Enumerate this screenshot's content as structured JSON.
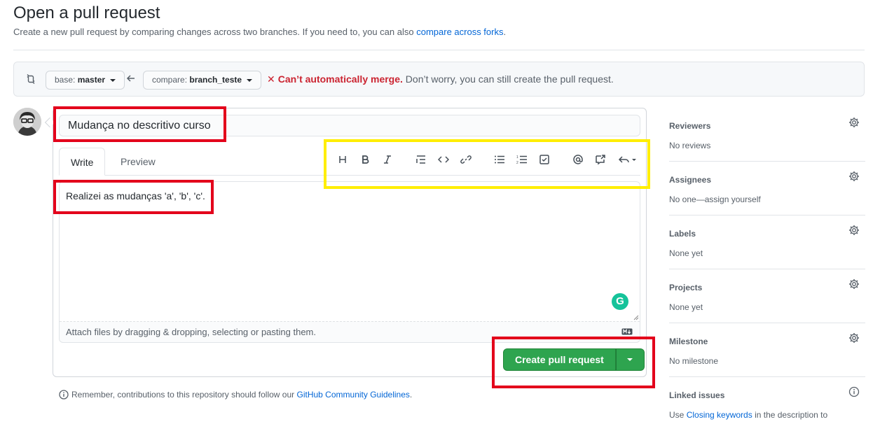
{
  "header": {
    "title": "Open a pull request",
    "subtitle_prefix": "Create a new pull request by comparing changes across two branches. If you need to, you can also ",
    "subtitle_link": "compare across forks",
    "subtitle_suffix": "."
  },
  "range": {
    "base_label": "base:",
    "base_value": "master",
    "compare_label": "compare:",
    "compare_value": "branch_teste",
    "merge_icon": "x-icon",
    "merge_status_bad": "Can’t automatically merge.",
    "merge_status_rest": " Don’t worry, you can still create the pull request."
  },
  "form": {
    "title_value": "Mudança no descritivo curso",
    "tabs": [
      {
        "label": "Write"
      },
      {
        "label": "Preview"
      }
    ],
    "toolbar": [
      "heading-icon",
      "bold-icon",
      "italic-icon",
      "quote-icon",
      "code-icon",
      "link-icon",
      "unordered-list-icon",
      "ordered-list-icon",
      "task-list-icon",
      "mention-icon",
      "reference-icon",
      "reply-icon"
    ],
    "body_value": "Realizei as mudanças 'a', 'b', 'c'.",
    "attach_text": "Attach files by dragging & dropping, selecting or pasting them.",
    "submit_label": "Create pull request"
  },
  "footer": {
    "prefix": "Remember, contributions to this repository should follow our ",
    "link": "GitHub Community Guidelines",
    "suffix": "."
  },
  "sidebar": {
    "reviewers": {
      "heading": "Reviewers",
      "value": "No reviews"
    },
    "assignees": {
      "heading": "Assignees",
      "value": "No one—assign yourself"
    },
    "labels": {
      "heading": "Labels",
      "value": "None yet"
    },
    "projects": {
      "heading": "Projects",
      "value": "None yet"
    },
    "milestone": {
      "heading": "Milestone",
      "value": "No milestone"
    },
    "linked_issues": {
      "heading": "Linked issues",
      "prefix": "Use ",
      "link": "Closing keywords",
      "suffix": " in the description to"
    }
  },
  "colors": {
    "primary_button": "#2ea44f",
    "link": "#0366d6",
    "error": "#cb2431",
    "annotation_red": "#e3001b",
    "annotation_yellow": "#ffee00"
  }
}
